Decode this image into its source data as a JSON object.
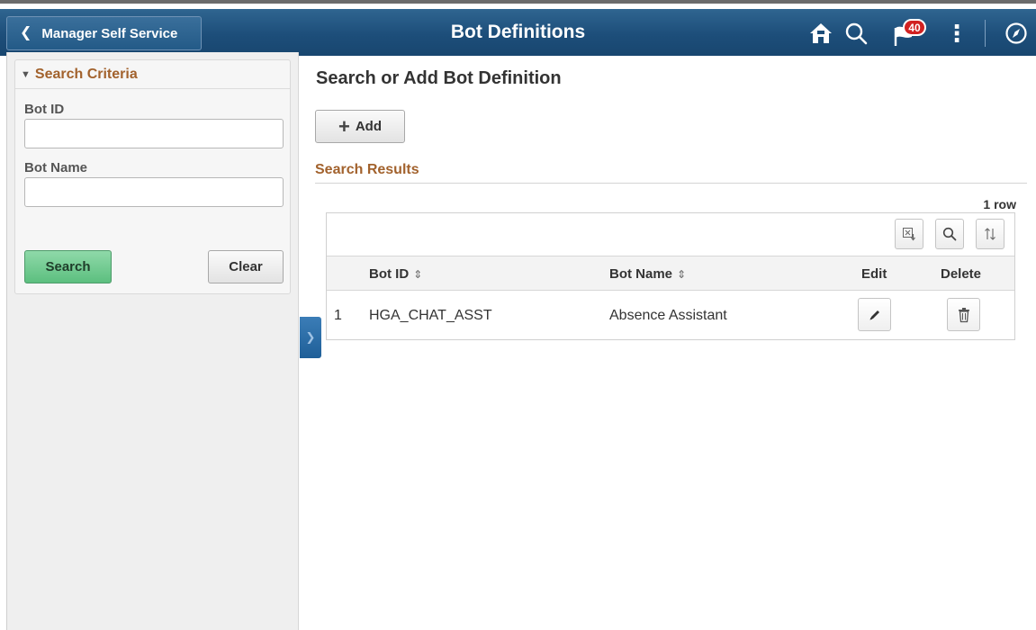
{
  "banner": {
    "back_label": "Manager Self Service",
    "title": "Bot Definitions",
    "notification_count": "40",
    "icons": [
      "home-icon",
      "search-icon",
      "flag-icon",
      "more-actions-icon",
      "navbar-compass-icon"
    ]
  },
  "search_criteria": {
    "heading": "Search Criteria",
    "bot_id_label": "Bot ID",
    "bot_id_value": "",
    "bot_name_label": "Bot Name",
    "bot_name_value": "",
    "search_label": "Search",
    "clear_label": "Clear"
  },
  "main": {
    "heading": "Search or Add Bot Definition",
    "add_label": "Add",
    "results_heading": "Search Results",
    "row_count": "1 row"
  },
  "grid": {
    "columns": [
      "Bot ID",
      "Bot Name",
      "Edit",
      "Delete"
    ],
    "rows": [
      {
        "num": "1",
        "bot_id": "HGA_CHAT_ASST",
        "bot_name": "Absence Assistant"
      }
    ]
  },
  "colors": {
    "banner": "#1d4e7a",
    "accent_brown": "#a2622d",
    "search_button": "#5cbf7f",
    "badge": "#d12121"
  }
}
